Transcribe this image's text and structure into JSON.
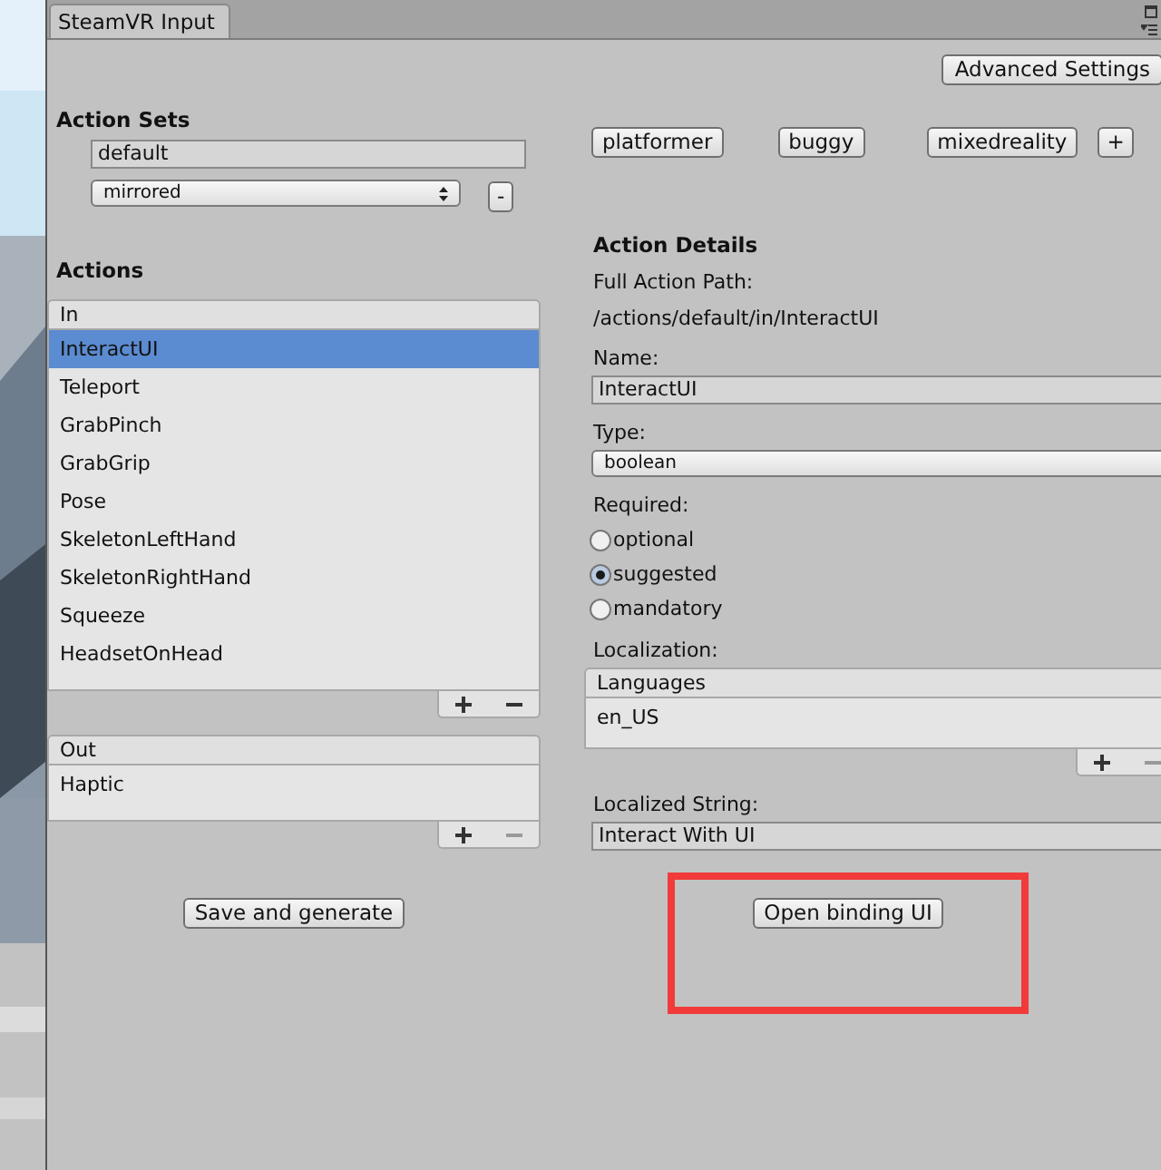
{
  "window": {
    "tab": "SteamVR Input"
  },
  "toolbar": {
    "advanced_button": "Advanced Settings"
  },
  "action_sets": {
    "heading": "Action Sets",
    "name_value": "default",
    "dropdown_value": "mirrored",
    "remove_button": "-",
    "add_button": "+",
    "sets": [
      {
        "label": "platformer"
      },
      {
        "label": "buggy"
      },
      {
        "label": "mixedreality"
      }
    ]
  },
  "actions": {
    "heading": "Actions",
    "lists": [
      {
        "header": "In",
        "remove_disabled": false,
        "items": [
          {
            "label": "InteractUI",
            "selected": true
          },
          {
            "label": "Teleport",
            "selected": false
          },
          {
            "label": "GrabPinch",
            "selected": false
          },
          {
            "label": "GrabGrip",
            "selected": false
          },
          {
            "label": "Pose",
            "selected": false
          },
          {
            "label": "SkeletonLeftHand",
            "selected": false
          },
          {
            "label": "SkeletonRightHand",
            "selected": false
          },
          {
            "label": "Squeeze",
            "selected": false
          },
          {
            "label": "HeadsetOnHead",
            "selected": false
          }
        ]
      },
      {
        "header": "Out",
        "remove_disabled": true,
        "items": [
          {
            "label": "Haptic",
            "selected": false
          }
        ]
      }
    ]
  },
  "details": {
    "heading": "Action Details",
    "path_label": "Full Action Path:",
    "path": "/actions/default/in/InteractUI",
    "name_label": "Name:",
    "name_value": "InteractUI",
    "type_label": "Type:",
    "type_value": "boolean",
    "required_label": "Required:",
    "required_options": [
      {
        "label": "optional",
        "selected": false
      },
      {
        "label": "suggested",
        "selected": true
      },
      {
        "label": "mandatory",
        "selected": false
      }
    ],
    "localization_label": "Localization:",
    "languages_header": "Languages",
    "languages": [
      {
        "label": "en_US"
      }
    ],
    "languages_remove_disabled": true,
    "localized_label": "Localized String:",
    "localized_value": "Interact With UI"
  },
  "buttons": {
    "save": "Save and generate",
    "open_binding": "Open binding UI",
    "open_binding_highlighted": true
  }
}
